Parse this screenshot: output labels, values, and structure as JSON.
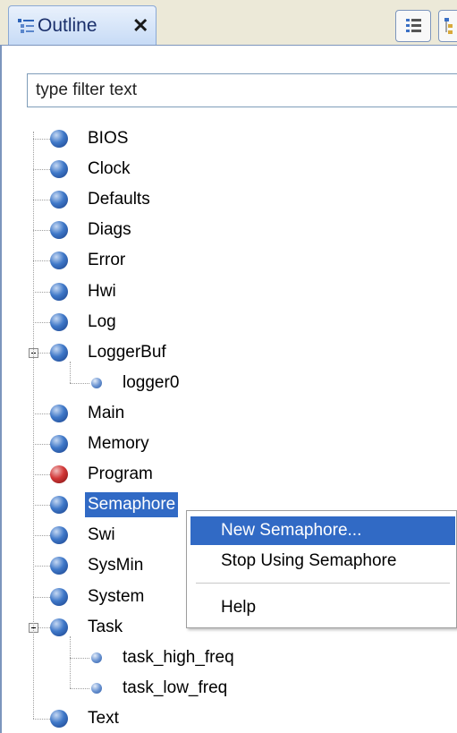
{
  "tab": {
    "title": "Outline",
    "close_glyph": "✕"
  },
  "filter": {
    "placeholder": "type filter text"
  },
  "tree": [
    {
      "label": "BIOS",
      "icon": "blue-ball-icon"
    },
    {
      "label": "Clock",
      "icon": "blue-ball-icon"
    },
    {
      "label": "Defaults",
      "icon": "blue-ball-icon"
    },
    {
      "label": "Diags",
      "icon": "blue-ball-icon"
    },
    {
      "label": "Error",
      "icon": "blue-ball-icon"
    },
    {
      "label": "Hwi",
      "icon": "blue-ball-icon"
    },
    {
      "label": "Log",
      "icon": "blue-ball-icon"
    },
    {
      "label": "LoggerBuf",
      "icon": "blue-ball-icon",
      "expanded": true,
      "children": [
        {
          "label": "logger0",
          "icon": "small-ball-icon"
        }
      ]
    },
    {
      "label": "Main",
      "icon": "blue-ball-icon"
    },
    {
      "label": "Memory",
      "icon": "blue-ball-icon"
    },
    {
      "label": "Program",
      "icon": "red-ball-icon"
    },
    {
      "label": "Semaphore",
      "icon": "blue-ball-icon",
      "selected": true
    },
    {
      "label": "Swi",
      "icon": "blue-ball-icon"
    },
    {
      "label": "SysMin",
      "icon": "blue-ball-icon"
    },
    {
      "label": "System",
      "icon": "blue-ball-icon"
    },
    {
      "label": "Task",
      "icon": "blue-ball-icon",
      "expanded": true,
      "children": [
        {
          "label": "task_high_freq",
          "icon": "small-ball-icon"
        },
        {
          "label": "task_low_freq",
          "icon": "small-ball-icon"
        }
      ]
    },
    {
      "label": "Text",
      "icon": "blue-ball-icon"
    }
  ],
  "context_menu": {
    "items": [
      "New Semaphore...",
      "Stop Using Semaphore",
      "Help"
    ],
    "highlighted": "New Semaphore..."
  },
  "colors": {
    "selection": "#316ac5",
    "tab_border": "#7c95bd",
    "module_icon": "#3f78c8",
    "program_icon": "#d23838"
  }
}
